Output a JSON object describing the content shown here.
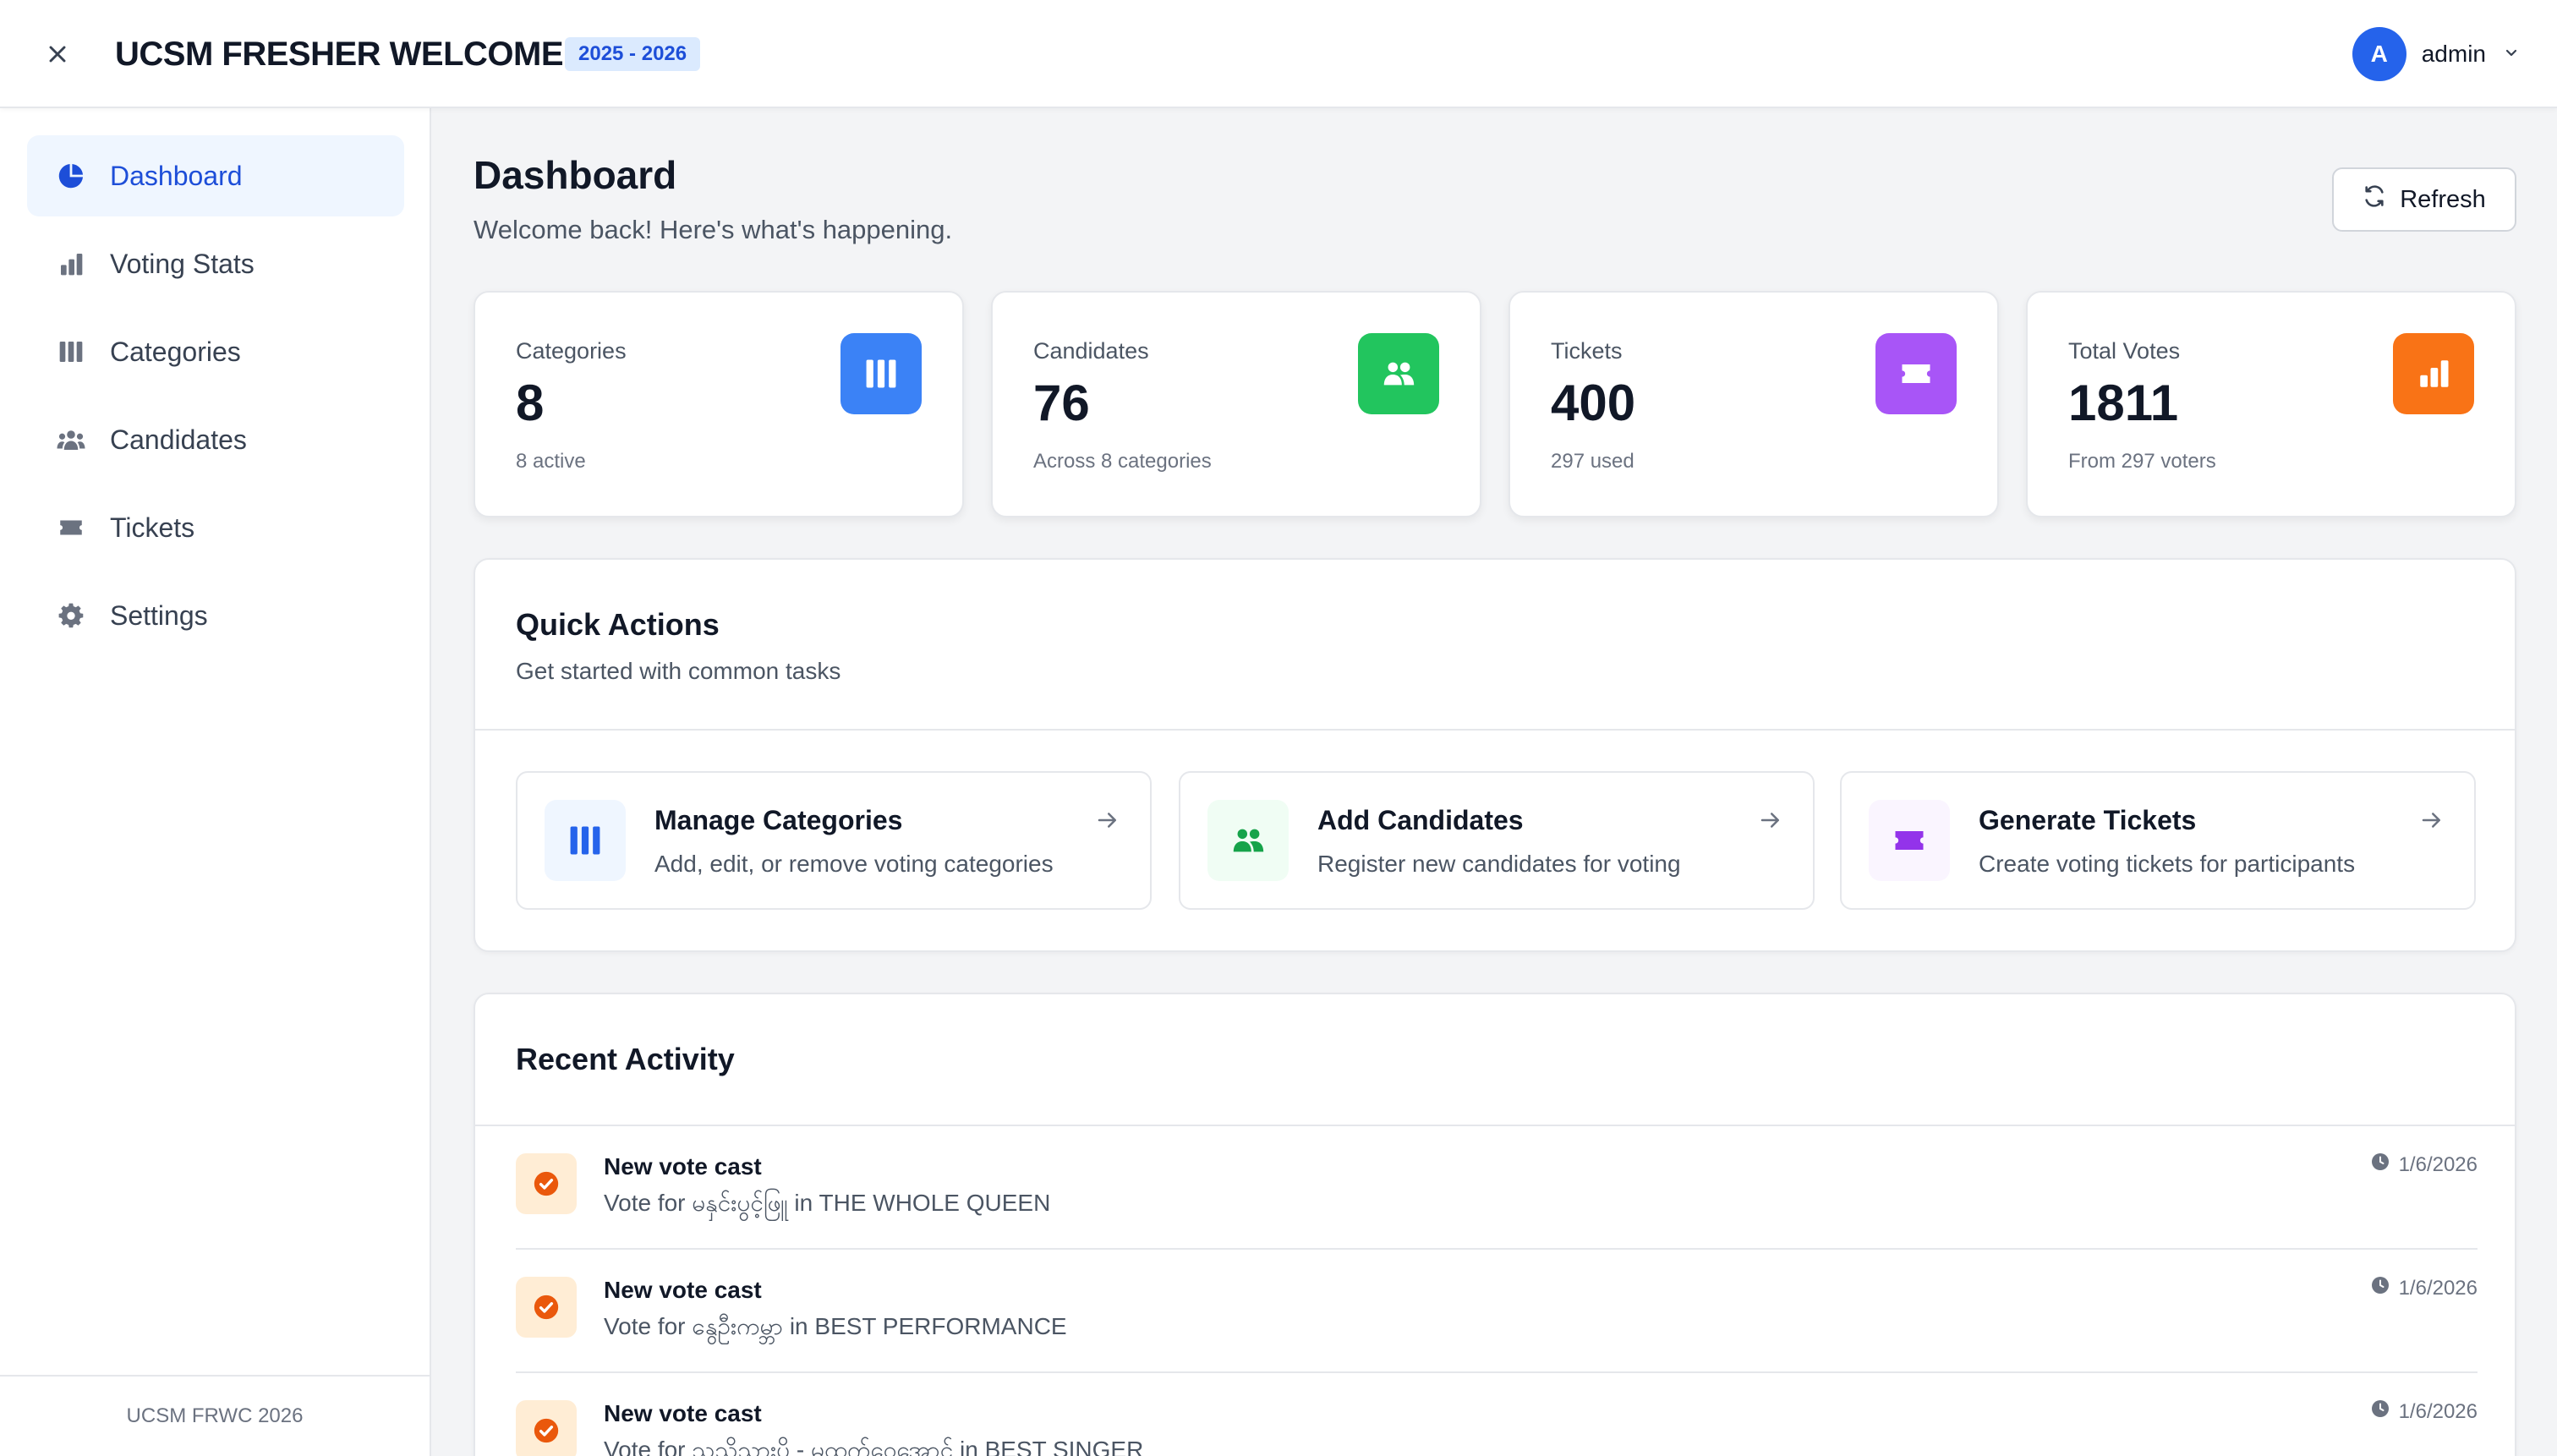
{
  "header": {
    "title": "UCSM FRESHER WELCOME",
    "year_badge": "2025 - 2026",
    "user": {
      "avatar_letter": "A",
      "name": "admin"
    }
  },
  "sidebar": {
    "items": [
      {
        "label": "Dashboard",
        "icon": "pie-chart-icon",
        "active": true
      },
      {
        "label": "Voting Stats",
        "icon": "bar-chart-icon",
        "active": false
      },
      {
        "label": "Categories",
        "icon": "columns-icon",
        "active": false
      },
      {
        "label": "Candidates",
        "icon": "users-icon",
        "active": false
      },
      {
        "label": "Tickets",
        "icon": "ticket-icon",
        "active": false
      },
      {
        "label": "Settings",
        "icon": "gear-icon",
        "active": false
      }
    ],
    "footer": "UCSM FRWC 2026"
  },
  "page": {
    "title": "Dashboard",
    "subtitle": "Welcome back! Here's what's happening.",
    "refresh_label": "Refresh"
  },
  "stats": [
    {
      "label": "Categories",
      "value": "8",
      "sub": "8 active",
      "icon": "columns-icon",
      "color": "#3b82f6"
    },
    {
      "label": "Candidates",
      "value": "76",
      "sub": "Across 8 categories",
      "icon": "users-icon",
      "color": "#22c55e"
    },
    {
      "label": "Tickets",
      "value": "400",
      "sub": "297 used",
      "icon": "ticket-icon",
      "color": "#a855f7"
    },
    {
      "label": "Total Votes",
      "value": "1811",
      "sub": "From 297 voters",
      "icon": "bar-chart-icon",
      "color": "#f97316"
    }
  ],
  "quick_actions": {
    "title": "Quick Actions",
    "subtitle": "Get started with common tasks",
    "items": [
      {
        "title": "Manage Categories",
        "desc": "Add, edit, or remove voting categories",
        "icon": "columns-icon"
      },
      {
        "title": "Add Candidates",
        "desc": "Register new candidates for voting",
        "icon": "users-icon"
      },
      {
        "title": "Generate Tickets",
        "desc": "Create voting tickets for participants",
        "icon": "ticket-icon"
      }
    ]
  },
  "recent_activity": {
    "title": "Recent Activity",
    "items": [
      {
        "title": "New vote cast",
        "desc": "Vote for မနှင်းပွင့်ဖြူ in THE WHOLE QUEEN",
        "time": "1/6/2026"
      },
      {
        "title": "New vote cast",
        "desc": "Vote for နွေဦးကမ္ဘာ in BEST PERFORMANCE",
        "time": "1/6/2026"
      },
      {
        "title": "New vote cast",
        "desc": "Vote for သသိသားပို - မထက်ဝေအောင် in BEST SINGER",
        "time": "1/6/2026"
      }
    ]
  },
  "colors": {
    "accent": "#1d4ed8",
    "blue": "#3b82f6",
    "green": "#22c55e",
    "purple": "#a855f7",
    "orange": "#f97316"
  }
}
